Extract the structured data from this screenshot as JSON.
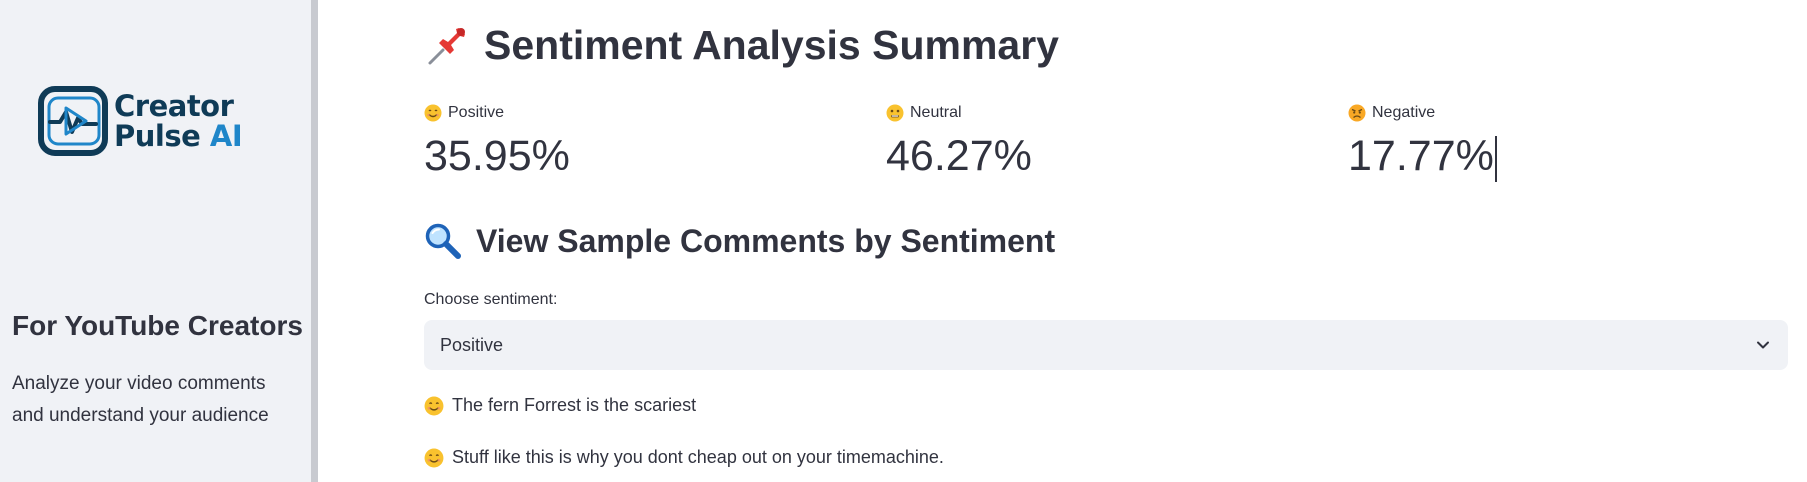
{
  "sidebar": {
    "logo": {
      "line1": "Creator",
      "line2": "Pulse",
      "line3": "AI"
    },
    "title": "For YouTube Creators",
    "description": "Analyze your video comments and understand your audience"
  },
  "main": {
    "summary_heading": "Sentiment Analysis Summary",
    "summary_icon": "pushpin-icon",
    "metrics": [
      {
        "label": "Positive",
        "value": "35.95%",
        "icon": "smiling-face-icon"
      },
      {
        "label": "Neutral",
        "value": "46.27%",
        "icon": "neutral-face-icon"
      },
      {
        "label": "Negative",
        "value": "17.77%",
        "icon": "angry-face-icon"
      }
    ],
    "samples_heading": "View Sample Comments by Sentiment",
    "samples_icon": "magnifying-glass-icon",
    "select": {
      "label": "Choose sentiment:",
      "value": "Positive"
    },
    "comments": [
      {
        "text": "The fern Forrest is the scariest",
        "icon": "smiling-face-icon"
      },
      {
        "text": "Stuff like this is why you dont cheap out on your timemachine.",
        "icon": "smiling-face-icon"
      }
    ]
  },
  "colors": {
    "sidebar_bg": "#f0f2f6",
    "text": "#31333f",
    "logo_dark": "#0f3b57",
    "logo_accent": "#1f86c9",
    "select_bg": "#f0f2f6"
  }
}
